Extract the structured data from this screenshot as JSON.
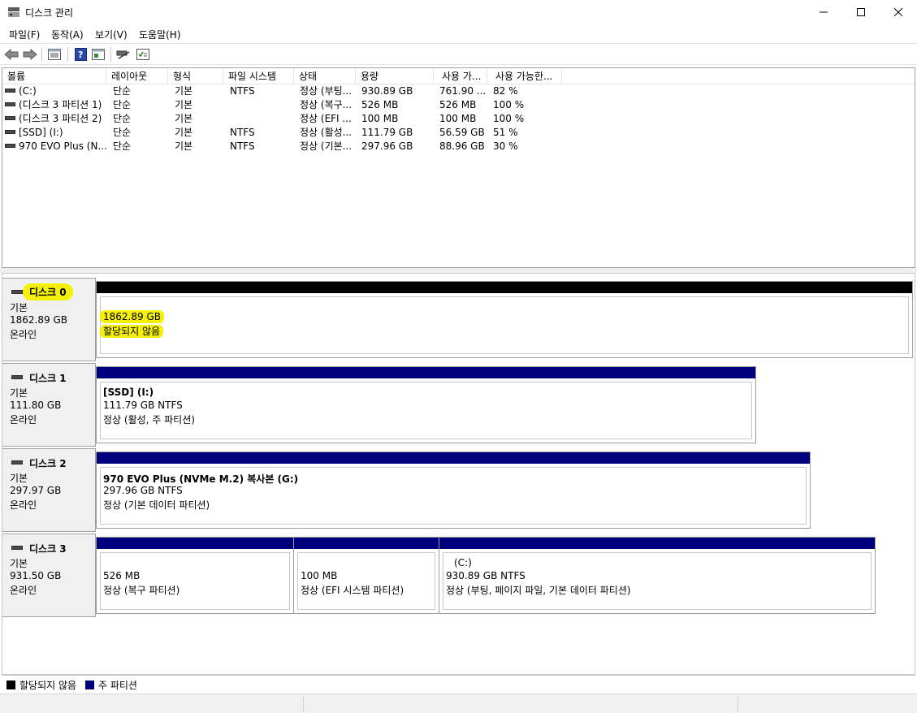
{
  "window": {
    "title": "디스크 관리"
  },
  "menu": {
    "file": "파일(F)",
    "action": "동작(A)",
    "view": "보기(V)",
    "help": "도움말(H)"
  },
  "toolbar": {
    "icons": [
      "back-arrow-icon",
      "forward-arrow-icon",
      "disk-list-icon",
      "help-icon",
      "pane-icon",
      "connect-icon",
      "properties-icon"
    ]
  },
  "volume_list": {
    "columns": [
      "볼륨",
      "레이아웃",
      "형식",
      "파일 시스템",
      "상태",
      "용량",
      "사용 가...",
      "사용 가능한..."
    ],
    "rows": [
      [
        "(C:)",
        "단순",
        "기본",
        "NTFS",
        "정상 (부팅...",
        "930.89 GB",
        "761.90 ...",
        "82 %"
      ],
      [
        "(디스크 3 파티션 1)",
        "단순",
        "기본",
        "",
        "정상 (복구...",
        "526 MB",
        "526 MB",
        "100 %"
      ],
      [
        "(디스크 3 파티션 2)",
        "단순",
        "기본",
        "",
        "정상 (EFI ...",
        "100 MB",
        "100 MB",
        "100 %"
      ],
      [
        "[SSD] (I:)",
        "단순",
        "기본",
        "NTFS",
        "정상 (활성...",
        "111.79 GB",
        "56.59 GB",
        "51 %"
      ],
      [
        "970 EVO Plus (N...",
        "단순",
        "기본",
        "NTFS",
        "정상 (기본...",
        "297.96 GB",
        "88.96 GB",
        "30 %"
      ]
    ]
  },
  "disks": [
    {
      "name": "디스크 0",
      "type": "기본",
      "size": "1862.89 GB",
      "status": "온라인",
      "partitions": [
        {
          "title": "",
          "size_line": "1862.89 GB",
          "status_line": "할당되지 않음",
          "kind": "unallocated"
        }
      ]
    },
    {
      "name": "디스크 1",
      "type": "기본",
      "size": "111.80 GB",
      "status": "온라인",
      "partitions": [
        {
          "title": "[SSD]  (I:)",
          "size_line": "111.79 GB NTFS",
          "status_line": "정상 (활성, 주 파티션)",
          "kind": "primary"
        }
      ]
    },
    {
      "name": "디스크 2",
      "type": "기본",
      "size": "297.97 GB",
      "status": "온라인",
      "partitions": [
        {
          "title": "970 EVO Plus (NVMe M.2) 복사본  (G:)",
          "size_line": "297.96 GB NTFS",
          "status_line": "정상 (기본 데이터 파티션)",
          "kind": "primary"
        }
      ]
    },
    {
      "name": "디스크 3",
      "type": "기본",
      "size": "931.50 GB",
      "status": "온라인",
      "partitions": [
        {
          "title": "",
          "size_line": "526 MB",
          "status_line": "정상 (복구 파티션)",
          "kind": "primary"
        },
        {
          "title": "",
          "size_line": "100 MB",
          "status_line": "정상 (EFI 시스템 파티션)",
          "kind": "primary"
        },
        {
          "title": "(C:)",
          "size_line": "930.89 GB NTFS",
          "status_line": "정상 (부팅, 페이지 파일, 기본 데이터 파티션)",
          "kind": "primary"
        }
      ]
    }
  ],
  "legend": {
    "unallocated": "할당되지 않음",
    "primary": "주 파티션"
  },
  "colors": {
    "unallocated": "#000000",
    "primary": "#00007f",
    "highlight": "#f5f00a"
  }
}
